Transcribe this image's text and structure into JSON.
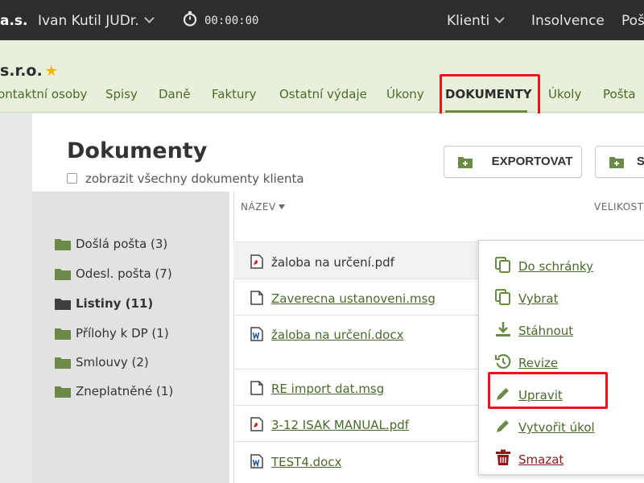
{
  "topbar": {
    "company_fragment": "a.s.",
    "user_name": "Ivan Kutil JUDr.",
    "timer": "00:00:00",
    "nav": {
      "klienti": "Klienti",
      "insolvence": "Insolvence",
      "posta": "Pošta"
    }
  },
  "client": {
    "name": "s.r.o.",
    "tabs": [
      "Kontaktní osoby",
      "Spisy",
      "Daně",
      "Faktury",
      "Ostatní výdaje",
      "Úkony",
      "DOKUMENTY",
      "Úkoly",
      "Pošta"
    ],
    "active_tab": "DOKUMENTY"
  },
  "page": {
    "title": "Dokumenty",
    "show_all_label": "zobrazit všechny dokumenty klienta",
    "export_button": "EXPORTOVAT",
    "second_button": "SPIS"
  },
  "folders": [
    {
      "label": "Došlá pošta (3)",
      "bold": false
    },
    {
      "label": "Odesl. pošta (7)",
      "bold": false
    },
    {
      "label": "Listiny (11)",
      "bold": true
    },
    {
      "label": "Přílohy k DP (1)",
      "bold": false
    },
    {
      "label": "Smlouvy (2)",
      "bold": false
    },
    {
      "label": "Zneplatněné (1)",
      "bold": false
    }
  ],
  "table": {
    "columns": {
      "name": "NÁZEV",
      "size": "VELIKOST"
    },
    "files": [
      {
        "name": "žaloba na určení.pdf",
        "icon": "pdf-file-icon"
      },
      {
        "name": "Zaverecna ustanoveni.msg",
        "icon": "file-icon"
      },
      {
        "name": "žaloba na určení.docx",
        "icon": "word-file-icon"
      },
      {
        "name": "RE import dat.msg",
        "icon": "file-icon"
      },
      {
        "name": "3-12 ISAK MANUAL.pdf",
        "icon": "pdf-file-icon"
      },
      {
        "name": "TEST4.docx",
        "icon": "word-file-icon"
      }
    ]
  },
  "context_menu": {
    "items": [
      {
        "label": "Do schránky",
        "icon": "copy-icon"
      },
      {
        "label": "Vybrat",
        "icon": "copy-icon"
      },
      {
        "label": "Stáhnout",
        "icon": "download-icon"
      },
      {
        "label": "Revize",
        "icon": "history-icon"
      },
      {
        "label": "Upravit",
        "icon": "pencil-icon"
      },
      {
        "label": "Vytvořit úkol",
        "icon": "pencil-icon"
      },
      {
        "label": "Smazat",
        "icon": "trash-icon"
      }
    ]
  },
  "colors": {
    "accent_green": "#4a6a2a",
    "highlight_red": "#e8141c",
    "danger": "#8b1a1a",
    "topbar": "#2d2d2d",
    "client_band": "#e8f0dc"
  }
}
